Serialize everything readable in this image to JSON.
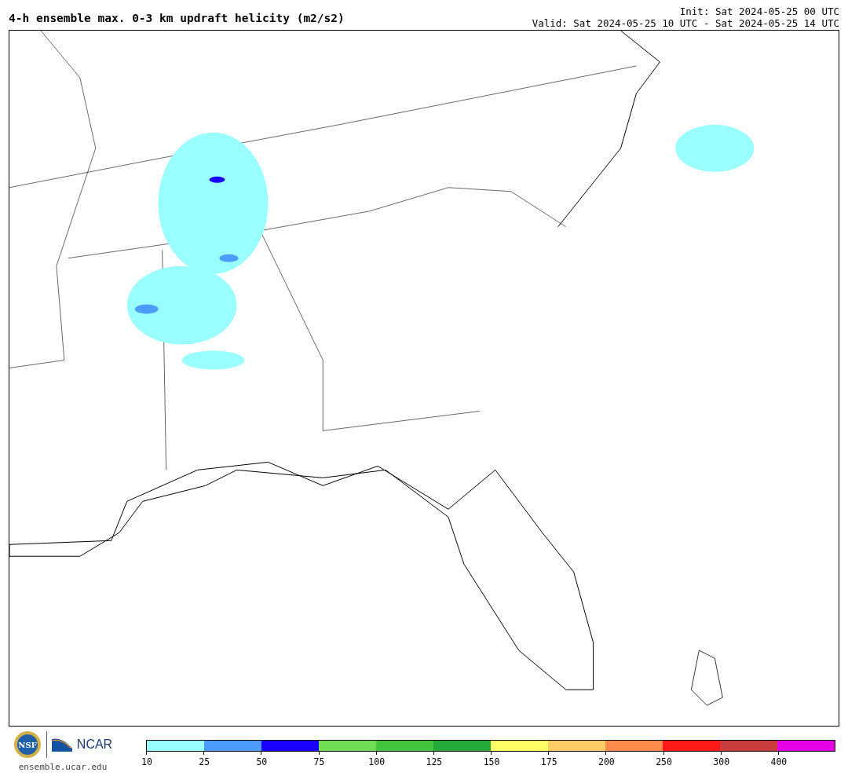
{
  "header": {
    "title": "4-h ensemble max. 0-3 km updraft helicity (m2/s2)",
    "init": "Init: Sat 2024-05-25 00 UTC",
    "valid": "Valid: Sat 2024-05-25 10 UTC - Sat 2024-05-25 14 UTC"
  },
  "footer": {
    "nsf_logo": "NSF",
    "ncar_logo": "NCAR",
    "site": "ensemble.ucar.edu"
  },
  "colorbar": {
    "bins": [
      {
        "label": "10",
        "color": "#99ffff"
      },
      {
        "label": "25",
        "color": "#4c9bff"
      },
      {
        "label": "50",
        "color": "#1a00ff"
      },
      {
        "label": "75",
        "color": "#71dd57"
      },
      {
        "label": "100",
        "color": "#44c43e"
      },
      {
        "label": "125",
        "color": "#24a93a"
      },
      {
        "label": "150",
        "color": "#ffff66"
      },
      {
        "label": "175",
        "color": "#ffcc66"
      },
      {
        "label": "200",
        "color": "#ff8c4c"
      },
      {
        "label": "250",
        "color": "#ff1a1a"
      },
      {
        "label": "300",
        "color": "#c83c3c"
      },
      {
        "label": "400",
        "color": "#e600e6"
      }
    ]
  }
}
